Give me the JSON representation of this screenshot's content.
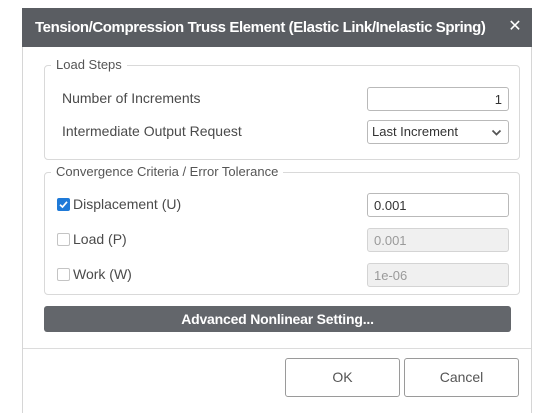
{
  "dialog": {
    "title": "Tension/Compression Truss Element (Elastic Link/Inelastic Spring)",
    "close_glyph": "✕"
  },
  "load_steps": {
    "legend": "Load Steps",
    "increments_label": "Number of Increments",
    "increments_value": "1",
    "output_label": "Intermediate Output Request",
    "output_selected": "Last Increment",
    "output_icon": "chevron-down-icon"
  },
  "convergence": {
    "legend": "Convergence Criteria / Error Tolerance",
    "items": [
      {
        "label": "Displacement (U)",
        "checked": true,
        "value": "0.001"
      },
      {
        "label": "Load (P)",
        "checked": false,
        "value": "0.001"
      },
      {
        "label": "Work (W)",
        "checked": false,
        "value": "1e-06"
      }
    ]
  },
  "advanced_button": "Advanced Nonlinear Setting...",
  "footer": {
    "ok": "OK",
    "cancel": "Cancel"
  },
  "colors": {
    "titlebar": "#5a5d62",
    "advanced_button": "#63666b",
    "checkbox_checked": "#1f7ad8"
  }
}
